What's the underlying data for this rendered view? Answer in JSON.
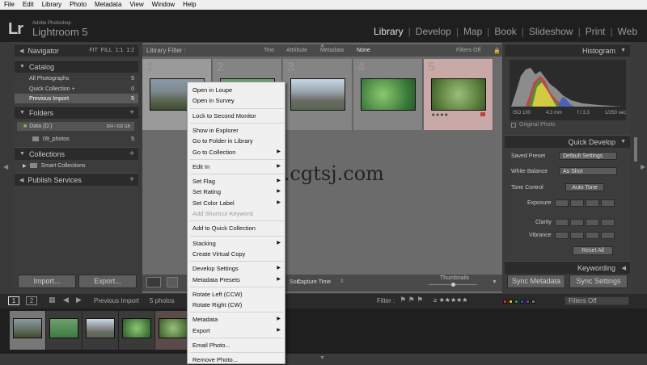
{
  "menubar": [
    "File",
    "Edit",
    "Library",
    "Photo",
    "Metadata",
    "View",
    "Window",
    "Help"
  ],
  "brand": {
    "logo": "Lr",
    "line1": "Adobe Photoshop",
    "line2": "Lightroom 5"
  },
  "modules": [
    {
      "label": "Library",
      "active": true
    },
    {
      "label": "Develop",
      "active": false
    },
    {
      "label": "Map",
      "active": false
    },
    {
      "label": "Book",
      "active": false
    },
    {
      "label": "Slideshow",
      "active": false
    },
    {
      "label": "Print",
      "active": false
    },
    {
      "label": "Web",
      "active": false
    }
  ],
  "left": {
    "navigator": {
      "title": "Navigator",
      "zoom": [
        "FIT",
        "FILL",
        "1:1",
        "1:2"
      ]
    },
    "catalog": {
      "title": "Catalog",
      "items": [
        {
          "label": "All Photographs",
          "count": "5"
        },
        {
          "label": "Quick Collection +",
          "count": "0"
        },
        {
          "label": "Previous Import",
          "count": "5"
        }
      ]
    },
    "folders": {
      "title": "Folders",
      "drive": "Data (D:)",
      "drive_size": "304 / 932 GB",
      "folder": "09_photos",
      "folder_count": "5"
    },
    "collections": {
      "title": "Collections",
      "items": [
        {
          "label": "Smart Collections"
        }
      ]
    },
    "publish": {
      "title": "Publish Services"
    },
    "import_label": "Import...",
    "export_label": "Export..."
  },
  "filterbar": {
    "title": "Library Filter :",
    "options": [
      "Text",
      "Attribute",
      "Metadata",
      "None"
    ],
    "active": "None",
    "preset": "Filters Off"
  },
  "grid": {
    "cells": [
      {
        "num": "1",
        "selected": true,
        "rejected": false
      },
      {
        "num": "2",
        "selected": false,
        "rejected": false
      },
      {
        "num": "3",
        "selected": false,
        "rejected": false
      },
      {
        "num": "4",
        "selected": false,
        "rejected": false
      },
      {
        "num": "5",
        "selected": false,
        "rejected": true,
        "stars": "★★★★"
      }
    ]
  },
  "toolbar": {
    "sort_label": "Sort:",
    "sort_value": "Capture Time",
    "thumb_label": "Thumbnails"
  },
  "right": {
    "histogram": {
      "title": "Histogram",
      "iso": "ISO 100",
      "focal": "4.3 mm",
      "aperture": "f / 3.3",
      "shutter": "1/250 sec",
      "original": "Original Photo"
    },
    "quick_develop": {
      "title": "Quick Develop",
      "saved_preset_label": "Saved Preset",
      "saved_preset_value": "Default Settings",
      "white_balance_label": "White Balance",
      "white_balance_value": "As Shot",
      "tone_control_label": "Tone Control",
      "auto_tone": "Auto Tone",
      "exposure": "Exposure",
      "clarity": "Clarity",
      "vibrance": "Vibrance",
      "reset_all": "Reset All"
    },
    "keywording": "Keywording",
    "sync_metadata": "Sync Metadata",
    "sync_settings": "Sync Settings"
  },
  "filmbar": {
    "page1": "1",
    "page2": "2",
    "source": "Previous Import",
    "count": "5 photos",
    "filter_label": "Filter :",
    "filter_value": "Filters Off"
  },
  "watermark": "www.cgtsj.com",
  "context_menu": [
    {
      "label": "Open in Loupe",
      "sub": false,
      "disabled": false
    },
    {
      "label": "Open in Survey",
      "sub": false,
      "disabled": false
    },
    {
      "sep": true
    },
    {
      "label": "Lock to Second Monitor",
      "sub": false,
      "disabled": false
    },
    {
      "sep": true
    },
    {
      "label": "Show in Explorer",
      "sub": false,
      "disabled": false
    },
    {
      "label": "Go to Folder in Library",
      "sub": false,
      "disabled": false
    },
    {
      "label": "Go to Collection",
      "sub": true,
      "disabled": false
    },
    {
      "sep": true
    },
    {
      "label": "Edit In",
      "sub": true,
      "disabled": false
    },
    {
      "sep": true
    },
    {
      "label": "Set Flag",
      "sub": true,
      "disabled": false
    },
    {
      "label": "Set Rating",
      "sub": true,
      "disabled": false
    },
    {
      "label": "Set Color Label",
      "sub": true,
      "disabled": false
    },
    {
      "label": "Add Shortcut Keyword",
      "sub": false,
      "disabled": true
    },
    {
      "sep": true
    },
    {
      "label": "Add to Quick Collection",
      "sub": false,
      "disabled": false
    },
    {
      "sep": true
    },
    {
      "label": "Stacking",
      "sub": true,
      "disabled": false
    },
    {
      "label": "Create Virtual Copy",
      "sub": false,
      "disabled": false
    },
    {
      "sep": true
    },
    {
      "label": "Develop Settings",
      "sub": true,
      "disabled": false
    },
    {
      "label": "Metadata Presets",
      "sub": true,
      "disabled": false
    },
    {
      "sep": true
    },
    {
      "label": "Rotate Left (CCW)",
      "sub": false,
      "disabled": false
    },
    {
      "label": "Rotate Right (CW)",
      "sub": false,
      "disabled": false
    },
    {
      "sep": true
    },
    {
      "label": "Metadata",
      "sub": true,
      "disabled": false
    },
    {
      "label": "Export",
      "sub": true,
      "disabled": false
    },
    {
      "sep": true
    },
    {
      "label": "Email Photo...",
      "sub": false,
      "disabled": false
    },
    {
      "sep": true
    },
    {
      "label": "Remove Photo...",
      "sub": false,
      "disabled": false
    }
  ],
  "colors": {
    "menu_bg": "#f0f0f0",
    "panel_bg": "#3c3c3c",
    "header_bg": "#2b2b2b",
    "identity_bg": "#1f1f1f",
    "reject": "#c9a8a8"
  }
}
